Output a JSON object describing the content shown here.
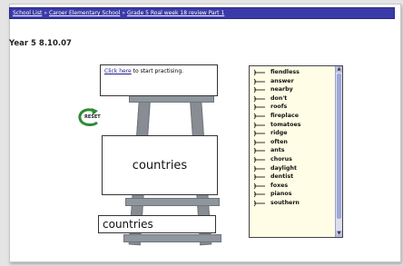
{
  "breadcrumb": {
    "items": [
      "School List",
      "Caroer Elementary School",
      "Grade 5 Roal week 18 review Part 1"
    ]
  },
  "page": {
    "date_title": "Year 5 8.10.07"
  },
  "practice": {
    "link_label": "Click here",
    "suffix": " to start practising."
  },
  "reset": {
    "label": "RESET",
    "icon": "reset-arrow-icon"
  },
  "display_word": "countries",
  "answer_value": "countries",
  "word_list": {
    "items": [
      "fiendless",
      "answer",
      "nearby",
      "don't",
      "roofs",
      "fireplace",
      "tomatoes",
      "ridge",
      "often",
      "ants",
      "chorus",
      "daylight",
      "dentist",
      "foxes",
      "pianos",
      "southern"
    ]
  },
  "colors": {
    "header_bar": "#3b3aa9",
    "list_bg": "#fffde6",
    "reset_arrow": "#2e8a35",
    "easel": "#888d94"
  }
}
